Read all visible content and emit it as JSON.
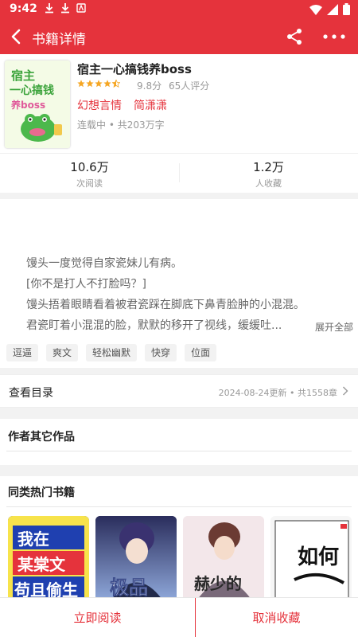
{
  "statusbar": {
    "time": "9:42",
    "icons": [
      "download-icon",
      "download-icon",
      "app-notification-icon"
    ]
  },
  "appbar": {
    "title": "书籍详情",
    "icons": [
      "back-arrow-icon",
      "share-icon",
      "more-icon"
    ]
  },
  "book": {
    "cover_text": "宿主一心搞钱养boss",
    "title": "宿主一心搞钱养boss",
    "rating_stars": 4.5,
    "score": "9.8分",
    "raters": "65人评分",
    "genre": "幻想言情",
    "author": "简潇潇",
    "status": "连载中 • 共203万字"
  },
  "stats": {
    "reads_value": "10.6万",
    "reads_label": "次阅读",
    "favorites_value": "1.2万",
    "favorites_label": "人收藏"
  },
  "synopsis": {
    "lines": [
      "馒头一度觉得自家瓷妹儿有病。",
      "[你不是打人不打脸吗？]",
      "馒头捂着眼睛看着被君瓷踩在脚底下鼻青脸肿的小混混。",
      "君瓷盯着小混混的脸，默默的移开了视线，缓缓吐..."
    ],
    "expand_label": "展开全部"
  },
  "tags": [
    "逗逼",
    "爽文",
    "轻松幽默",
    "快穿",
    "位面"
  ],
  "catalog": {
    "label": "查看目录",
    "meta": "2024-08-24更新 • 共1558章"
  },
  "sections": {
    "author_works": "作者其它作品",
    "similar_hot": "同类热门书籍"
  },
  "similar_books": [
    {
      "cover_text_1": "我在",
      "cover_text_2": "某棠文",
      "cover_text_3": "苟且偷生"
    },
    {
      "cover_text": "极品"
    },
    {
      "cover_text": "赫少的"
    },
    {
      "cover_text": "如何"
    }
  ],
  "bottom": {
    "read_now": "立即阅读",
    "cancel_favorite": "取消收藏"
  },
  "colors": {
    "brand": "#e5333c",
    "star": "#f5a623",
    "gray_text": "#999999"
  }
}
